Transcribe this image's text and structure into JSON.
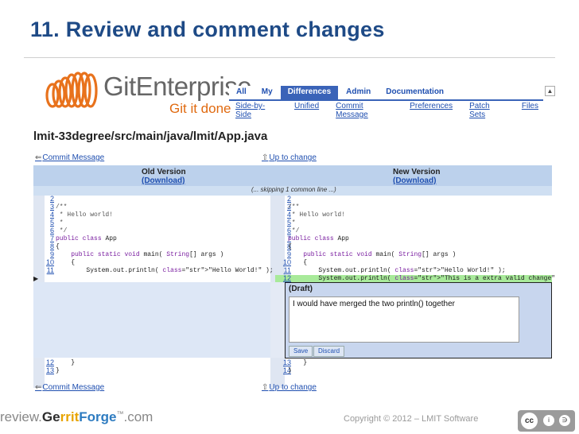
{
  "slide": {
    "title": "11. Review and comment changes",
    "footer_logo": {
      "prefix": "review.",
      "g": "Ge",
      "rrit": "rrit",
      "forge": "Forge",
      "tm": "™",
      "suffix": ".com"
    },
    "copyright": "Copyright © 2012 – LMIT Software",
    "cc_badge": {
      "c": "cc",
      "by": "i",
      "sa": "∋"
    }
  },
  "app": {
    "logo_name": "GitEnterprise",
    "logo_tagline": "Git it done",
    "tabs": [
      {
        "label": "All",
        "active": false
      },
      {
        "label": "My",
        "active": false
      },
      {
        "label": "Differences",
        "active": true
      },
      {
        "label": "Admin",
        "active": false
      },
      {
        "label": "Documentation",
        "active": false
      }
    ],
    "subtabs": [
      "Side-by-Side",
      "Unified",
      "Commit Message",
      "Preferences",
      "Patch Sets",
      "Files"
    ],
    "file_path": "lmit-33degree/src/main/java/lmit/App.java",
    "nav": {
      "commit_message": "Commit Message",
      "up_to_change": "Up to change"
    }
  },
  "diff": {
    "old_title": "Old Version",
    "new_title": "New Version",
    "download": "(Download)",
    "skip_text": "(... skipping 1 common line ...)",
    "left_lines": [
      {
        "n": "2",
        "t": ""
      },
      {
        "n": "3",
        "t": "/**"
      },
      {
        "n": "4",
        "t": " * Hello world!"
      },
      {
        "n": "5",
        "t": " *"
      },
      {
        "n": "6",
        "t": " */"
      },
      {
        "n": "7",
        "t": "public class App"
      },
      {
        "n": "8",
        "t": "{"
      },
      {
        "n": "9",
        "t": "    public static void main( String[] args )"
      },
      {
        "n": "10",
        "t": "    {"
      },
      {
        "n": "11",
        "t": "        System.out.println( \"Hello World!\" );"
      }
    ],
    "right_lines": [
      {
        "n": "2",
        "t": ""
      },
      {
        "n": "3",
        "t": "/**"
      },
      {
        "n": "4",
        "t": " * Hello world!"
      },
      {
        "n": "5",
        "t": " *"
      },
      {
        "n": "6",
        "t": " */"
      },
      {
        "n": "7",
        "t": "public class App"
      },
      {
        "n": "8",
        "t": "{"
      },
      {
        "n": "9",
        "t": "    public static void main( String[] args )"
      },
      {
        "n": "10",
        "t": "    {"
      },
      {
        "n": "11",
        "t": "        System.out.println( \"Hello World!\" );"
      },
      {
        "n": "12",
        "t": "        System.out.println( \"This is a extra valid change\" );"
      }
    ],
    "left_tail": [
      {
        "n": "12",
        "t": "    }"
      },
      {
        "n": "13",
        "t": "}"
      }
    ],
    "right_tail": [
      {
        "n": "13",
        "t": "    }"
      },
      {
        "n": "14",
        "t": "}"
      }
    ],
    "comment": {
      "heading": "(Draft)",
      "text": "I would have merged the two println() together",
      "save": "Save",
      "discard": "Discard"
    }
  }
}
